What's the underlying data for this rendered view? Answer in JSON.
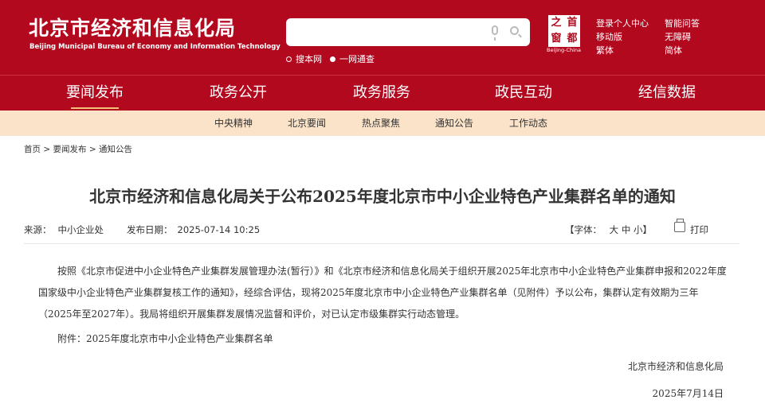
{
  "header": {
    "logo_cn": "北京市经济和信息化局",
    "logo_en": "Beijing Municipal Bureau of Economy and Information Technology",
    "search": {
      "placeholder": "",
      "scope_site": "搜本网",
      "scope_all": "一网通查"
    },
    "seal": {
      "chars": [
        "首",
        "都",
        "之",
        "窗"
      ],
      "caption": "Beijing-China"
    },
    "utils": {
      "login": "登录个人中心",
      "smart_qa": "智能问答",
      "mobile": "移动版",
      "accessible": "无障碍",
      "traditional": "繁体",
      "simplified": "简体"
    }
  },
  "nav": {
    "items": [
      {
        "label": "要闻发布"
      },
      {
        "label": "政务公开"
      },
      {
        "label": "政务服务"
      },
      {
        "label": "政民互动"
      },
      {
        "label": "经信数据"
      }
    ],
    "active_index": 0
  },
  "subnav": {
    "items": [
      {
        "label": "中央精神"
      },
      {
        "label": "北京要闻"
      },
      {
        "label": "热点聚焦"
      },
      {
        "label": "通知公告"
      },
      {
        "label": "工作动态"
      }
    ]
  },
  "breadcrumb": {
    "home": "首页",
    "sep": " > ",
    "level1": "要闻发布",
    "level2": "通知公告"
  },
  "article": {
    "title": "北京市经济和信息化局关于公布2025年度北京市中小企业特色产业集群名单的通知",
    "source_label": "来源：",
    "source": "中小企业处",
    "date_label": "发布日期：",
    "date": "2025-07-14 10:25",
    "font_label": "【字体：",
    "font_large": "大",
    "font_medium": "中",
    "font_small": "小",
    "font_close": "】",
    "print_label": "打印",
    "body": "按照《北京市促进中小企业特色产业集群发展管理办法(暂行）》和《北京市经济和信息化局关于组织开展2025年北京市中小企业特色产业集群申报和2022年度国家级中小企业特色产业集群复核工作的通知》，经综合评估，现将2025年度北京市中小企业特色产业集群名单（见附件）予以公布，集群认定有效期为三年（2025年至2027年）。我局将组织开展集群发展情况监督和评价，对已认定市级集群实行动态管理。",
    "attachment_label": "附件：",
    "attachment": "2025年度北京市中小企业特色产业集群名单",
    "signature_org": "北京市经济和信息化局",
    "signature_date": "2025年7月14日"
  },
  "colors": {
    "brand_red": "#b3091f",
    "subnav_bg": "#fbe3c9",
    "active_underline": "#f4c37a"
  }
}
